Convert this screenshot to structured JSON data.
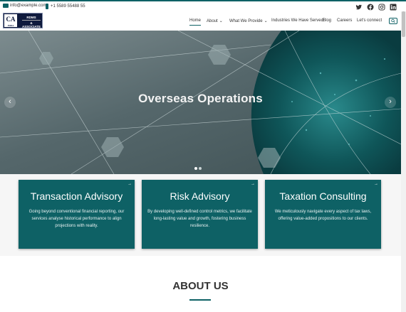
{
  "topbar": {
    "email": "info@example.com",
    "phone": "+1 5589 55488 55",
    "social": [
      "twitter-icon",
      "facebook-icon",
      "instagram-icon",
      "linkedin-icon"
    ]
  },
  "logo": {
    "mark": "CA",
    "mark_sub": "INDIA",
    "line1": "RDMS",
    "line2": "&",
    "line3": "ASSOCIATE"
  },
  "nav": {
    "items": [
      "Home",
      "About",
      "What We Provide",
      "Industries We Have Served",
      "Blog",
      "Careers",
      "Let's connect"
    ],
    "active": "Home"
  },
  "hero": {
    "title": "Overseas Operations",
    "prev_glyph": "‹",
    "next_glyph": "›",
    "slide_count": 2,
    "active_slide": 1
  },
  "services": [
    {
      "title": "Transaction Advisory",
      "desc": "Going beyond conventional financial reporting, our services analyse historical performance to align projections with reality."
    },
    {
      "title": "Risk Advisory",
      "desc": "By developing well-defined control metrics, we facilitate long-lasting value and growth, fostering business resilience."
    },
    {
      "title": "Taxation Consulting",
      "desc": "We meticulously navigate every aspect of tax laws, offering value-added propositions to our clients."
    }
  ],
  "about": {
    "title": "ABOUT US"
  },
  "colors": {
    "brand_teal": "#0e6165",
    "logo_navy": "#0f1a3d"
  }
}
